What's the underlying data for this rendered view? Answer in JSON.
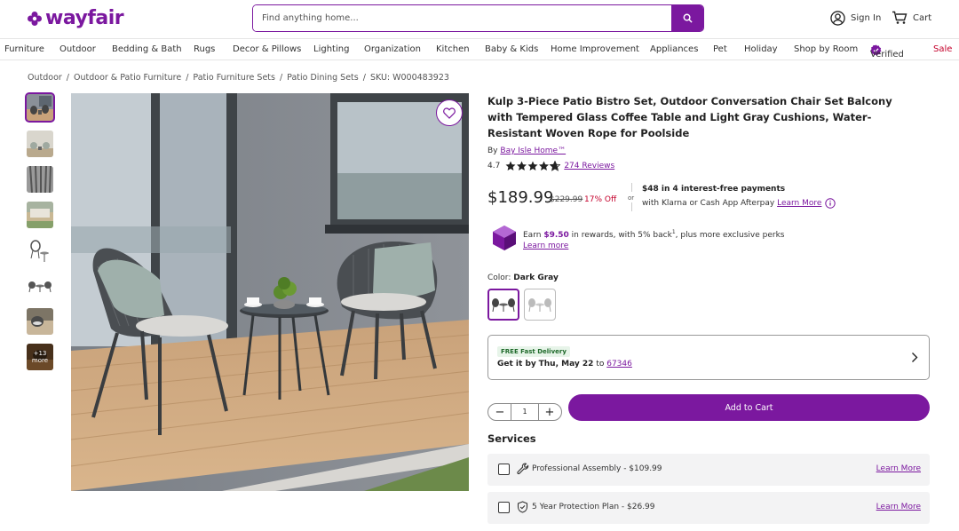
{
  "header": {
    "logo": "wayfair",
    "search_placeholder": "Find anything home...",
    "sign_in": "Sign In",
    "cart": "Cart"
  },
  "nav": [
    "Furniture",
    "Outdoor",
    "Bedding & Bath",
    "Rugs",
    "Decor & Pillows",
    "Lighting",
    "Organization",
    "Kitchen",
    "Baby & Kids",
    "Home Improvement",
    "Appliances",
    "Pet",
    "Holiday",
    "Shop by Room",
    "Verified",
    "Sale"
  ],
  "breadcrumb": [
    "Outdoor",
    "Outdoor & Patio Furniture",
    "Patio Furniture Sets",
    "Patio Dining Sets",
    "SKU: W000483923"
  ],
  "thumbs": {
    "more_count": "+13",
    "more_label": "more"
  },
  "product": {
    "title": "Kulp 3-Piece Patio Bistro Set, Outdoor Conversation Chair Set Balcony with Tempered Glass Coffee Table and Light Gray Cushions, Water-Resistant Woven Rope for Poolside",
    "by": "By",
    "brand": "Bay Isle Home™",
    "rating": "4.7",
    "rating_value": 4.7,
    "reviews": "274 Reviews",
    "price": "$189.99",
    "old_price": "$229.99",
    "discount": "17% Off",
    "or": "or",
    "installment": "$48 in 4 interest-free payments",
    "installment_sub": "with Klarna or Cash App Afterpay",
    "learn_more": "Learn More",
    "reward_earn": "Earn",
    "reward_amount": "$9.50",
    "reward_rest": "in rewards, with 5% back",
    "reward_sup": "1",
    "reward_tail": ", plus more exclusive perks",
    "reward_link": "Learn more",
    "color_label": "Color:",
    "color_value": "Dark Gray",
    "free_delivery": "FREE Fast Delivery",
    "get_it_by": "Get it by",
    "delivery_date": "Thu, May 22",
    "to": "to",
    "zip": "67346",
    "quantity": "1",
    "add_to_cart": "Add to Cart"
  },
  "services": {
    "title": "Services",
    "items": [
      {
        "label": "Professional Assembly - $109.99",
        "link": "Learn More",
        "icon": "wrench-icon"
      },
      {
        "label": "5 Year Protection Plan - $26.99",
        "link": "Learn More",
        "icon": "shield-check-icon"
      }
    ]
  },
  "colors": {
    "brand": "#7b189f",
    "sale": "#c4002b",
    "delivery_badge": "#e7f4e9"
  }
}
